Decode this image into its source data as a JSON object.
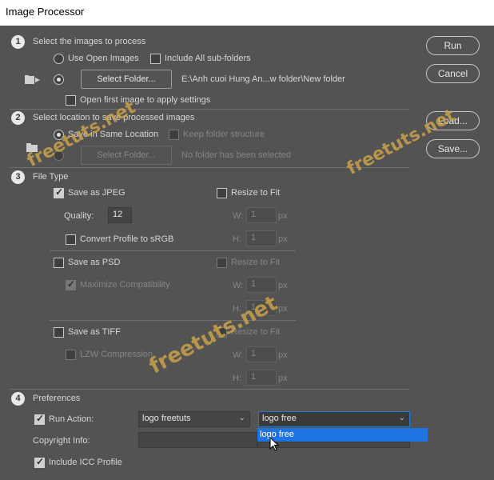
{
  "window": {
    "title": "Image Processor"
  },
  "section1": {
    "number": "1",
    "title": "Select the images to process",
    "use_open_images": "Use Open Images",
    "include_subfolders": "Include All sub-folders",
    "select_folder_btn": "Select Folder...",
    "folder_path": "E:\\Anh cuoi Hung An...w folder\\New folder",
    "open_first": "Open first image to apply settings"
  },
  "section2": {
    "number": "2",
    "title": "Select location to save processed images",
    "save_same": "Save in Same Location",
    "keep_structure": "Keep folder structure",
    "select_folder_btn": "Select Folder...",
    "no_folder": "No folder has been selected"
  },
  "section3": {
    "number": "3",
    "title": "File Type",
    "jpeg": {
      "save_label": "Save as JPEG",
      "resize_label": "Resize to Fit",
      "quality_label": "Quality:",
      "quality_value": "12",
      "w_label": "W:",
      "w_value": "1",
      "h_label": "H:",
      "h_value": "1",
      "unit": "px",
      "convert_label": "Convert Profile to sRGB"
    },
    "psd": {
      "save_label": "Save as PSD",
      "resize_label": "Resize to Fit",
      "maximize_label": "Maximize Compatibility",
      "w_label": "W:",
      "w_value": "1",
      "h_label": "H:",
      "h_value": "1",
      "unit": "px"
    },
    "tiff": {
      "save_label": "Save as TIFF",
      "resize_label": "Resize to Fit",
      "lzw_label": "LZW Compression",
      "w_label": "W:",
      "w_value": "1",
      "h_label": "H:",
      "h_value": "1",
      "unit": "px"
    }
  },
  "section4": {
    "number": "4",
    "title": "Preferences",
    "run_action": "Run Action:",
    "action_set": "logo freetuts",
    "action_name": "logo free",
    "dropdown_option": "logo free",
    "copyright_label": "Copyright Info:",
    "copyright_value": "",
    "icc_label": "Include ICC Profile"
  },
  "buttons": {
    "run": "Run",
    "cancel": "Cancel",
    "load": "Load...",
    "save": "Save..."
  },
  "watermark": {
    "text": "freetuts.net"
  },
  "colors": {
    "background": "#535353",
    "highlight": "#1e73e0",
    "watermark": "#c9a24a"
  }
}
